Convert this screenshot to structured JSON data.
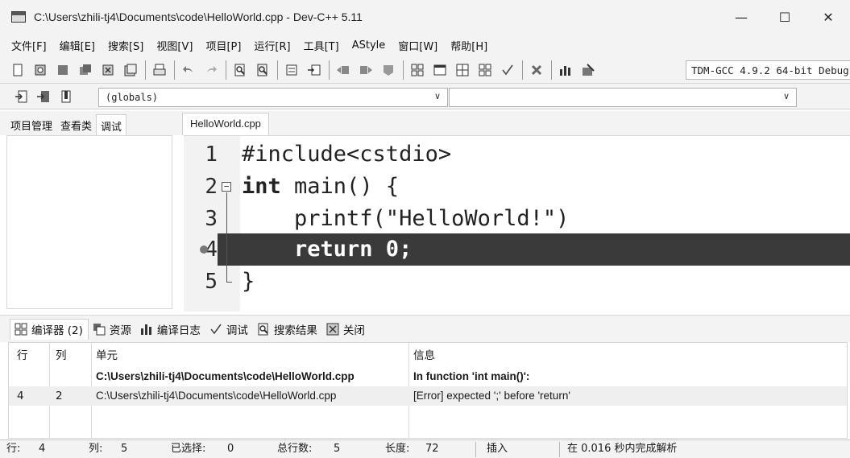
{
  "window": {
    "title": "C:\\Users\\zhili-tj4\\Documents\\code\\HelloWorld.cpp - Dev-C++ 5.11",
    "minimize": "—",
    "maximize": "☐",
    "close": "✕"
  },
  "menu": [
    "文件[F]",
    "编辑[E]",
    "搜索[S]",
    "视图[V]",
    "项目[P]",
    "运行[R]",
    "工具[T]",
    "AStyle",
    "窗口[W]",
    "帮助[H]"
  ],
  "toolbar": {
    "compiler": "TDM-GCC 4.9.2 64-bit Debug"
  },
  "toolbar2": {
    "scope": "(globals)",
    "member": ""
  },
  "left_panel": {
    "tabs": [
      "项目管理",
      "查看类",
      "调试"
    ],
    "active_tab": "调试"
  },
  "editor": {
    "file_tab": "HelloWorld.cpp",
    "lines": [
      {
        "num": "1",
        "text": "#include<cstdio>"
      },
      {
        "num": "2",
        "kw": "int",
        "text": " main() {"
      },
      {
        "num": "3",
        "text": "    printf(\"HelloWorld!\")"
      },
      {
        "num": "4",
        "text": "    return 0;"
      },
      {
        "num": "5",
        "text": "}"
      }
    ],
    "highlighted_line": 4
  },
  "bottom_tabs": [
    {
      "label": "编译器 (2)",
      "icon": "grid-icon"
    },
    {
      "label": "资源",
      "icon": "resources-icon"
    },
    {
      "label": "编译日志",
      "icon": "bar-chart-icon"
    },
    {
      "label": "调试",
      "icon": "check-icon"
    },
    {
      "label": "搜索结果",
      "icon": "search-doc-icon"
    },
    {
      "label": "关闭",
      "icon": "close-panel-icon"
    }
  ],
  "messages": {
    "headers": {
      "line": "行",
      "col": "列",
      "unit": "单元",
      "info": "信息"
    },
    "rows": [
      {
        "line": "",
        "col": "",
        "unit": "C:\\Users\\zhili-tj4\\Documents\\code\\HelloWorld.cpp",
        "info": "In function 'int main()':",
        "bold": true
      },
      {
        "line": "4",
        "col": "2",
        "unit": "C:\\Users\\zhili-tj4\\Documents\\code\\HelloWorld.cpp",
        "info": "[Error] expected ';' before 'return'",
        "bold": false
      }
    ]
  },
  "status": {
    "line_label": "行:",
    "line_value": "4",
    "col_label": "列:",
    "col_value": "5",
    "sel_label": "已选择:",
    "sel_value": "0",
    "total_label": "总行数:",
    "total_value": "5",
    "len_label": "长度:",
    "len_value": "72",
    "mode": "插入",
    "parse": "在 0.016 秒内完成解析"
  }
}
